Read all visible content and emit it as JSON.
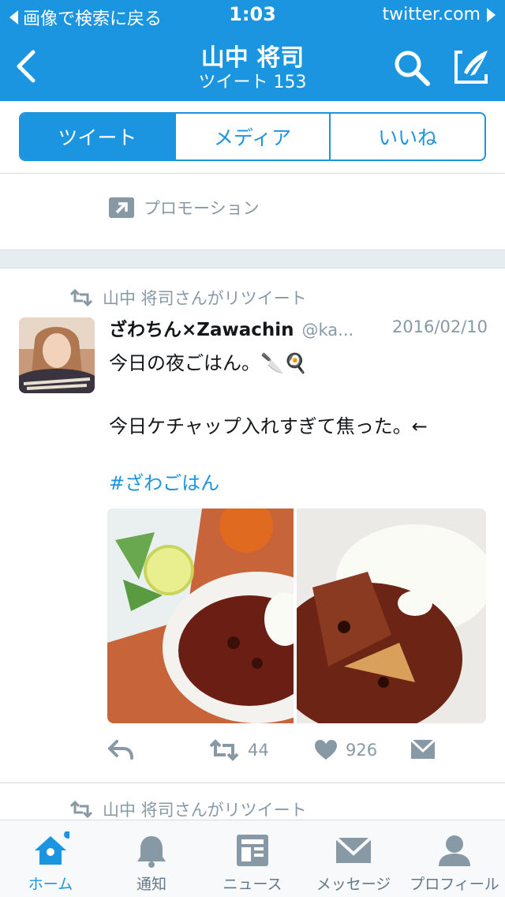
{
  "colors": {
    "accent": "#1b95e0",
    "muted": "#8899a6",
    "text": "#14171a",
    "tab_inactive": "#657786"
  },
  "status_bar": {
    "back_label": "画像で検索に戻る",
    "time": "1:03",
    "site": "twitter.com"
  },
  "nav": {
    "title": "山中 将司",
    "subtitle": "ツイート 153",
    "icons": [
      "back-icon",
      "search-icon",
      "compose-icon"
    ]
  },
  "segments": [
    {
      "label": "ツイート",
      "selected": true
    },
    {
      "label": "メディア",
      "selected": false
    },
    {
      "label": "いいね",
      "selected": false
    }
  ],
  "promotion": {
    "label": "プロモーション"
  },
  "tweet": {
    "retweeted_by": "山中 将司さんがリツイート",
    "name": "ざわちん×Zawachin",
    "handle": "@ka...",
    "date": "2016/02/10",
    "line1": "今日の夜ごはん。🔪🍳",
    "line2": "今日ケチャップ入れすぎて焦った。←",
    "hashtag": "#ざわごはん",
    "retweets": "44",
    "likes": "926"
  },
  "next_tweet": {
    "retweeted_by": "山中 将司さんがリツイート"
  },
  "tabbar": [
    {
      "label": "ホーム",
      "icon": "home-icon",
      "active": true
    },
    {
      "label": "通知",
      "icon": "bell-icon",
      "active": false
    },
    {
      "label": "ニュース",
      "icon": "news-icon",
      "active": false
    },
    {
      "label": "メッセージ",
      "icon": "mail-icon",
      "active": false
    },
    {
      "label": "プロフィール",
      "icon": "person-icon",
      "active": false
    }
  ]
}
